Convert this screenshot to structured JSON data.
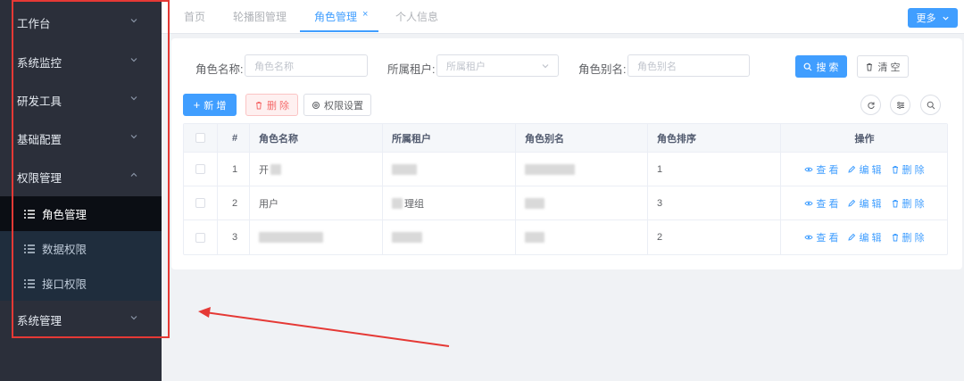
{
  "sidebar": {
    "items": [
      {
        "label": "工作台",
        "expanded": false
      },
      {
        "label": "系统监控",
        "expanded": false
      },
      {
        "label": "研发工具",
        "expanded": false
      },
      {
        "label": "基础配置",
        "expanded": false
      },
      {
        "label": "权限管理",
        "expanded": true
      },
      {
        "label": "系统管理",
        "expanded": false
      }
    ],
    "sub_items": [
      {
        "label": "角色管理",
        "active": true
      },
      {
        "label": "数据权限",
        "active": false
      },
      {
        "label": "接口权限",
        "active": false
      }
    ]
  },
  "tabs": [
    {
      "label": "首页",
      "active": false
    },
    {
      "label": "轮播图管理",
      "active": false
    },
    {
      "label": "角色管理",
      "active": true,
      "closable": true
    },
    {
      "label": "个人信息",
      "active": false
    }
  ],
  "more_button": "更多",
  "search_form": {
    "role_name_label": "角色名称:",
    "role_name_placeholder": "角色名称",
    "tenant_label": "所属租户:",
    "tenant_placeholder": "所属租户",
    "alias_label": "角色别名:",
    "alias_placeholder": "角色别名",
    "search_button": "搜 索",
    "clear_button": "清 空"
  },
  "toolbar": {
    "add_button": "新 增",
    "delete_button": "删 除",
    "permission_button": "权限设置"
  },
  "table": {
    "headers": {
      "index": "#",
      "name": "角色名称",
      "tenant": "所属租户",
      "alias": "角色别名",
      "sort": "角色排序",
      "ops": "操作"
    },
    "rows": [
      {
        "index": "1",
        "name": "开",
        "tenant": "",
        "alias": "",
        "sort": "1"
      },
      {
        "index": "2",
        "name": "用户",
        "tenant": "理组",
        "alias": "",
        "sort": "3"
      },
      {
        "index": "3",
        "name": "",
        "tenant": "",
        "alias": "",
        "sort": "2"
      }
    ],
    "actions": {
      "view": "查 看",
      "edit": "编 辑",
      "delete": "删 除"
    }
  },
  "colors": {
    "primary": "#409eff",
    "sidebar": "#2b2f3a",
    "annotation": "#e53935",
    "danger": "#f56c6c"
  }
}
